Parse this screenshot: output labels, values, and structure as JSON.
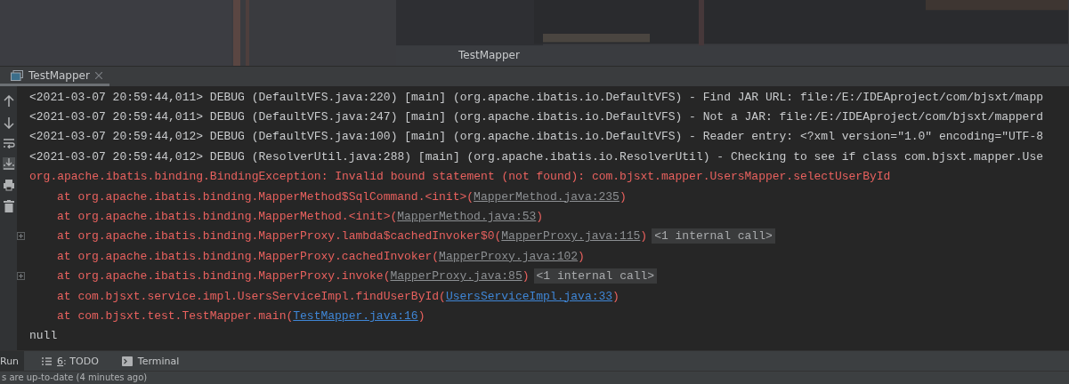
{
  "window": {
    "title": "TestMapper"
  },
  "run_tab": {
    "label": "TestMapper",
    "selected": true
  },
  "console": {
    "lines": [
      {
        "kind": "debug",
        "text": "<2021-03-07 20:59:44,011> DEBUG (DefaultVFS.java:220) [main] (org.apache.ibatis.io.DefaultVFS) - Find JAR URL: file:/E:/IDEAproject/com/bjsxt/mapp"
      },
      {
        "kind": "debug",
        "text": "<2021-03-07 20:59:44,011> DEBUG (DefaultVFS.java:247) [main] (org.apache.ibatis.io.DefaultVFS) - Not a JAR: file:/E:/IDEAproject/com/bjsxt/mapperd"
      },
      {
        "kind": "debug",
        "text": "<2021-03-07 20:59:44,012> DEBUG (DefaultVFS.java:100) [main] (org.apache.ibatis.io.DefaultVFS) - Reader entry: <?xml version=\"1.0\" encoding=\"UTF-8"
      },
      {
        "kind": "debug",
        "text": "<2021-03-07 20:59:44,012> DEBUG (ResolverUtil.java:288) [main] (org.apache.ibatis.io.ResolverUtil) - Checking to see if class com.bjsxt.mapper.Use"
      },
      {
        "kind": "error",
        "text": "org.apache.ibatis.binding.BindingException: Invalid bound statement (not found): com.bjsxt.mapper.UsersMapper.selectUserById"
      },
      {
        "kind": "frame",
        "text": "at org.apache.ibatis.binding.MapperMethod$SqlCommand.<init>(",
        "link": "MapperMethod.java:235",
        "user_code": false,
        "close": ")"
      },
      {
        "kind": "frame",
        "text": "at org.apache.ibatis.binding.MapperMethod.<init>(",
        "link": "MapperMethod.java:53",
        "user_code": false,
        "close": ")"
      },
      {
        "kind": "frame",
        "text": "at org.apache.ibatis.binding.MapperProxy.lambda$cachedInvoker$0(",
        "link": "MapperProxy.java:115",
        "user_code": false,
        "close": ")",
        "folded": "<1 internal call>"
      },
      {
        "kind": "frame",
        "text": "at org.apache.ibatis.binding.MapperProxy.cachedInvoker(",
        "link": "MapperProxy.java:102",
        "user_code": false,
        "close": ")"
      },
      {
        "kind": "frame",
        "text": "at org.apache.ibatis.binding.MapperProxy.invoke(",
        "link": "MapperProxy.java:85",
        "user_code": false,
        "close": ")",
        "folded": "<1 internal call>"
      },
      {
        "kind": "frame",
        "text": "at com.bjsxt.service.impl.UsersServiceImpl.findUserById(",
        "link": "UsersServiceImpl.java:33",
        "user_code": true,
        "close": ")"
      },
      {
        "kind": "frame",
        "text": "at com.bjsxt.test.TestMapper.main(",
        "link": "TestMapper.java:16",
        "user_code": true,
        "close": ")"
      },
      {
        "kind": "output",
        "text": "null"
      }
    ]
  },
  "tool_tabs": [
    {
      "kind": "run",
      "label": "Run",
      "selected": true
    },
    {
      "kind": "todo",
      "mnemonic": "6",
      "label": ": TODO",
      "selected": false
    },
    {
      "kind": "terminal",
      "label": "Terminal",
      "selected": false
    }
  ],
  "status_bar": {
    "text": "s are up-to-date (4 minutes ago)"
  }
}
